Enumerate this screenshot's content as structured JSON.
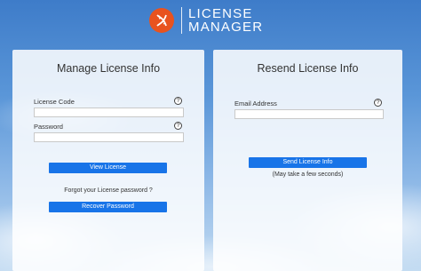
{
  "brand": {
    "line1": "LICENSE",
    "line2": "MANAGER",
    "logo_icon": "dna-helix-icon",
    "logo_color": "#e8531f"
  },
  "manage": {
    "title": "Manage License Info",
    "license_code_label": "License Code",
    "license_code_value": "",
    "password_label": "Password",
    "password_value": "",
    "help_glyph": "?",
    "view_button": "View License",
    "forgot_text": "Forgot your License password ?",
    "recover_button": "Recover Password"
  },
  "resend": {
    "title": "Resend License Info",
    "email_label": "Email Address",
    "email_value": "",
    "help_glyph": "?",
    "send_button": "Send License Info",
    "note": "(May take a few seconds)"
  },
  "colors": {
    "button_blue": "#1874e8",
    "sky_top": "#3e7cc9"
  }
}
